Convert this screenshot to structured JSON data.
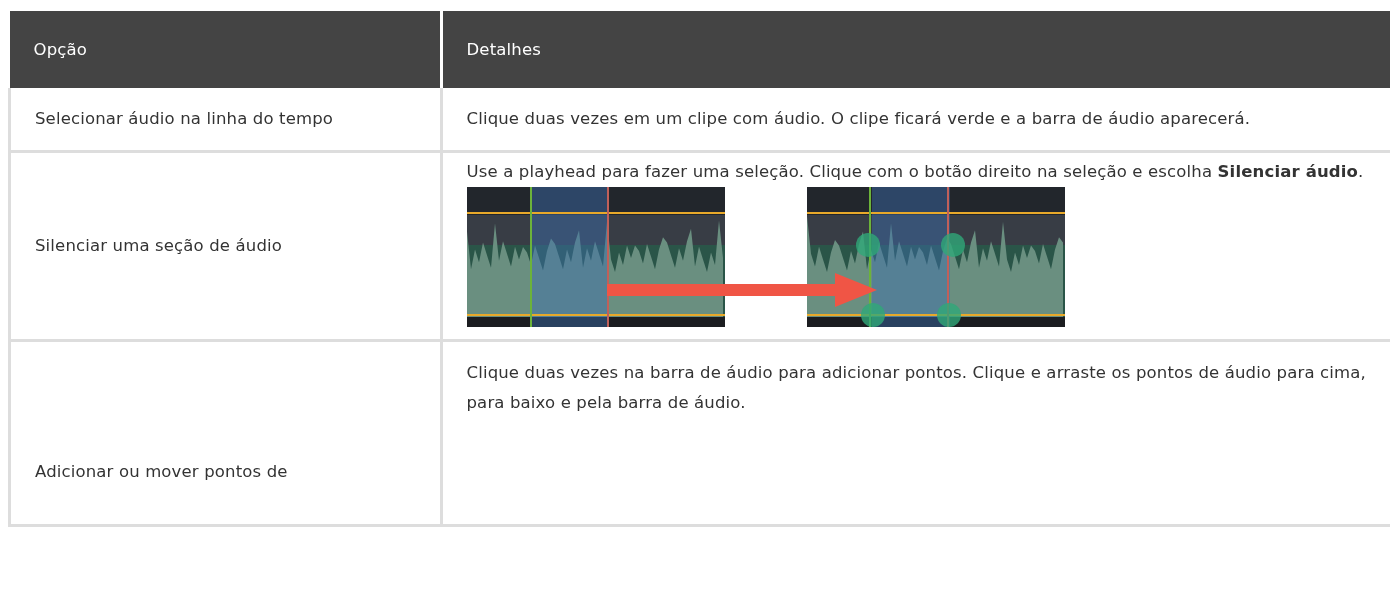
{
  "table": {
    "columns": [
      "Opção",
      "Detalhes"
    ],
    "rows": [
      {
        "kind": "text",
        "option": "Selecionar áudio na linha do tempo",
        "details": "Clique duas vezes em um clipe com áudio. O clipe ficará verde e a barra de áudio aparecerá."
      },
      {
        "kind": "images",
        "option": "Silenciar uma seção de áudio",
        "details": "Use a playhead para fazer uma seleção. Clique com o botão direito na seleção e escolha **Silenciar áudio**."
      },
      {
        "kind": "text",
        "option": "Adicionar ou mover pontos de",
        "details": "Clique duas vezes na barra de áudio para adicionar pontos. Clique e arraste os pontos de áudio para cima, para baixo e pela barra de áudio."
      }
    ]
  }
}
